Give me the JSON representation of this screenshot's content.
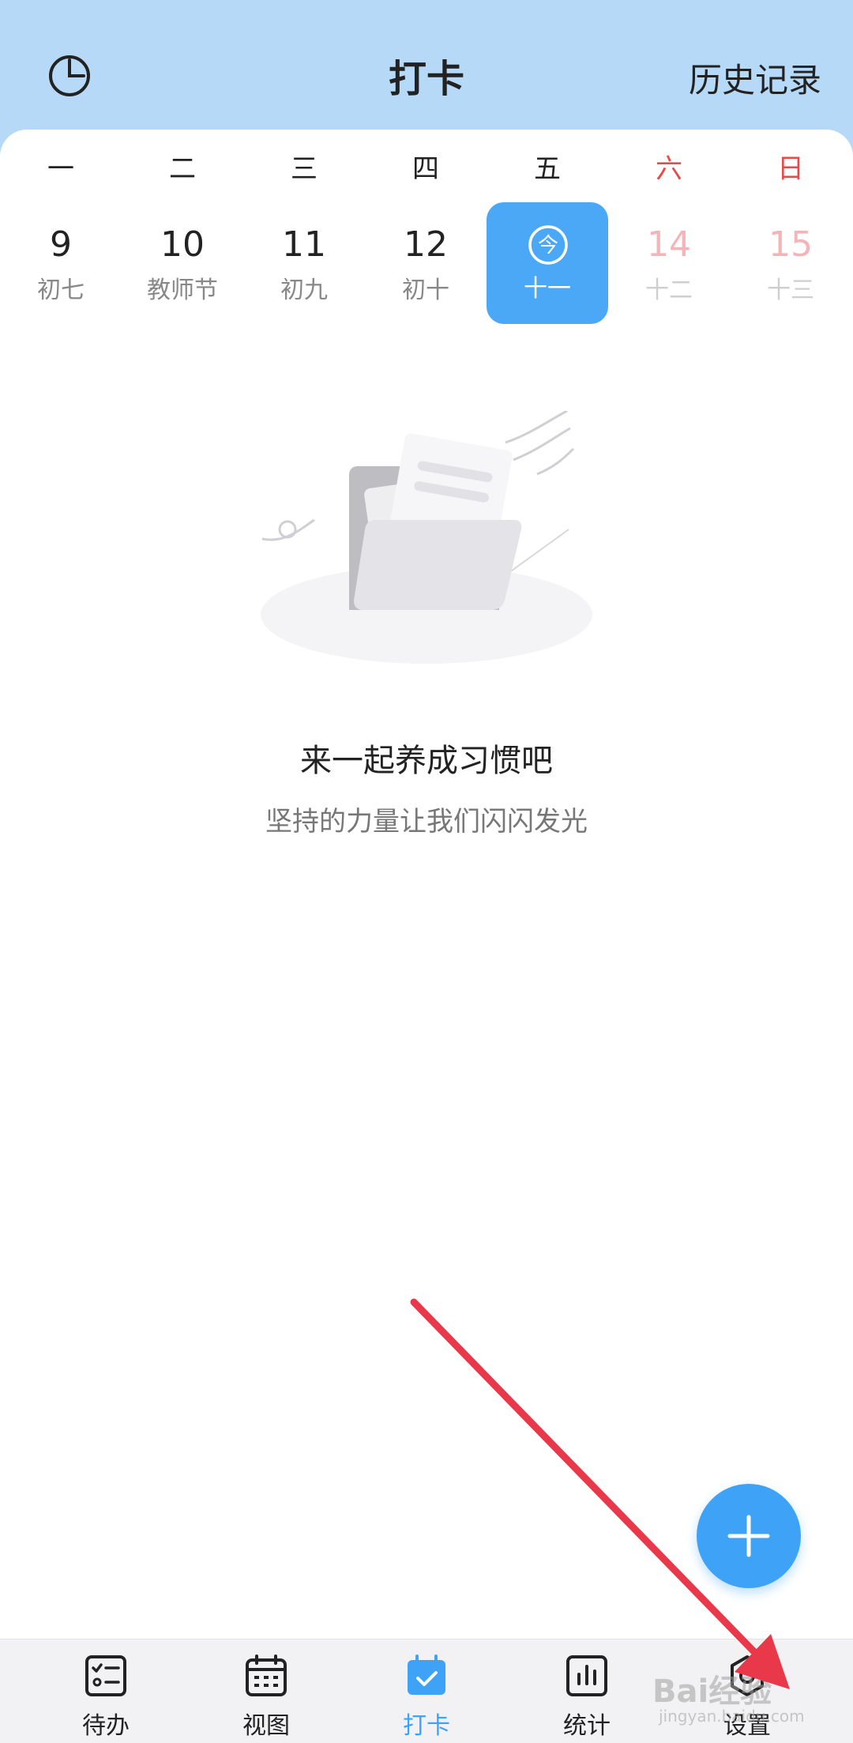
{
  "header": {
    "title": "打卡",
    "history_label": "历史记录",
    "left_icon": "clock-icon"
  },
  "week": {
    "weekdays": [
      "一",
      "二",
      "三",
      "四",
      "五",
      "六",
      "日"
    ],
    "days": [
      {
        "num": "9",
        "lunar": "初七"
      },
      {
        "num": "10",
        "lunar": "教师节"
      },
      {
        "num": "11",
        "lunar": "初九"
      },
      {
        "num": "12",
        "lunar": "初十"
      },
      {
        "num": "",
        "lunar": "十一",
        "today_badge": "今"
      },
      {
        "num": "14",
        "lunar": "十二"
      },
      {
        "num": "15",
        "lunar": "十三"
      }
    ]
  },
  "empty_state": {
    "title": "来一起养成习惯吧",
    "subtitle": "坚持的力量让我们闪闪发光",
    "illustration": "folder-illustration"
  },
  "fab": {
    "icon": "plus-icon"
  },
  "nav": {
    "items": [
      {
        "label": "待办",
        "icon": "todo-list-icon"
      },
      {
        "label": "视图",
        "icon": "calendar-grid-icon"
      },
      {
        "label": "打卡",
        "icon": "calendar-check-icon",
        "active": true
      },
      {
        "label": "统计",
        "icon": "bar-chart-icon"
      },
      {
        "label": "设置",
        "icon": "gear-icon"
      }
    ]
  },
  "watermark": {
    "text": "Bai经验",
    "sub": "jingyan.baidu.com"
  },
  "colors": {
    "header_bg": "#b5d9f7",
    "accent": "#3ea3f7",
    "weekend_red": "#e84a4a",
    "annotation_red": "#e8384a"
  }
}
